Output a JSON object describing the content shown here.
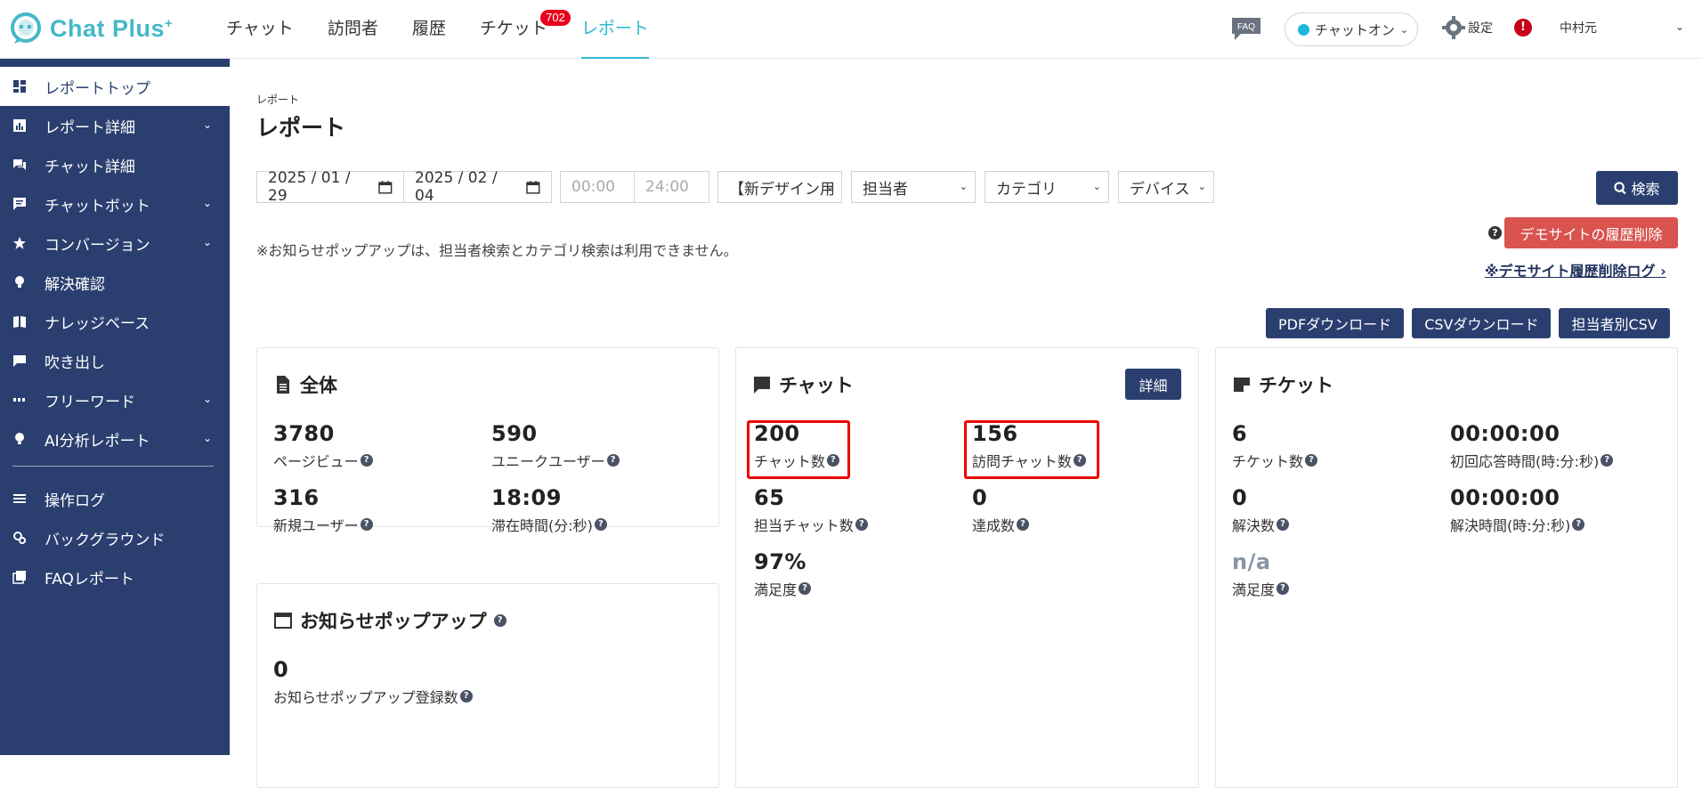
{
  "brand": {
    "name": "Chat Plus",
    "sup": "+"
  },
  "topnav": {
    "items": [
      "チャット",
      "訪問者",
      "履歴",
      "チケット",
      "レポート"
    ],
    "ticket_badge": "702"
  },
  "header": {
    "faq": "FAQ",
    "status": "チャットオン",
    "settings": "設定",
    "alert": "!",
    "user": "中村元"
  },
  "sidebar": {
    "items": [
      "レポートトップ",
      "レポート詳細",
      "チャット詳細",
      "チャットボット",
      "コンバージョン",
      "解決確認",
      "ナレッジベース",
      "吹き出し",
      "フリーワード",
      "AI分析レポート"
    ],
    "items2": [
      "操作ログ",
      "バックグラウンド",
      "FAQレポート"
    ]
  },
  "page": {
    "breadcrumb": "レポート",
    "title": "レポート"
  },
  "filters": {
    "date_from": "2025 / 01 / 29",
    "date_to": "2025 / 02 / 04",
    "time_from": "00:00",
    "time_to": "24:00",
    "site": "【新デザイン用",
    "agent": "担当者",
    "category": "カテゴリ",
    "device": "デバイス",
    "search": "検索"
  },
  "notice": "※お知らせポップアップは、担当者検索とカテゴリ検索は利用できません。",
  "demo": {
    "help": "?",
    "delete": "デモサイトの履歴削除",
    "log": "※デモサイト履歴削除ログ ›"
  },
  "downloads": [
    "PDFダウンロード",
    "CSVダウンロード",
    "担当者別CSV"
  ],
  "overall": {
    "title": "全体",
    "stats": [
      {
        "value": "3780",
        "label": "ページビュー"
      },
      {
        "value": "590",
        "label": "ユニークユーザー"
      },
      {
        "value": "316",
        "label": "新規ユーザー"
      },
      {
        "value": "18:09",
        "label": "滞在時間(分:秒)"
      }
    ]
  },
  "popup": {
    "title": "お知らせポップアップ",
    "stats": [
      {
        "value": "0",
        "label": "お知らせポップアップ登録数"
      }
    ]
  },
  "chat": {
    "title": "チャット",
    "detail": "詳細",
    "stats": [
      {
        "value": "200",
        "label": "チャット数"
      },
      {
        "value": "156",
        "label": "訪問チャット数"
      },
      {
        "value": "65",
        "label": "担当チャット数"
      },
      {
        "value": "0",
        "label": "達成数"
      },
      {
        "value": "97%",
        "label": "満足度"
      }
    ]
  },
  "ticket": {
    "title": "チケット",
    "stats": [
      {
        "value": "6",
        "label": "チケット数"
      },
      {
        "value": "00:00:00",
        "label": "初回応答時間(時:分:秒)"
      },
      {
        "value": "0",
        "label": "解決数"
      },
      {
        "value": "00:00:00",
        "label": "解決時間(時:分:秒)"
      },
      {
        "value": "n/a",
        "label": "満足度"
      }
    ]
  }
}
